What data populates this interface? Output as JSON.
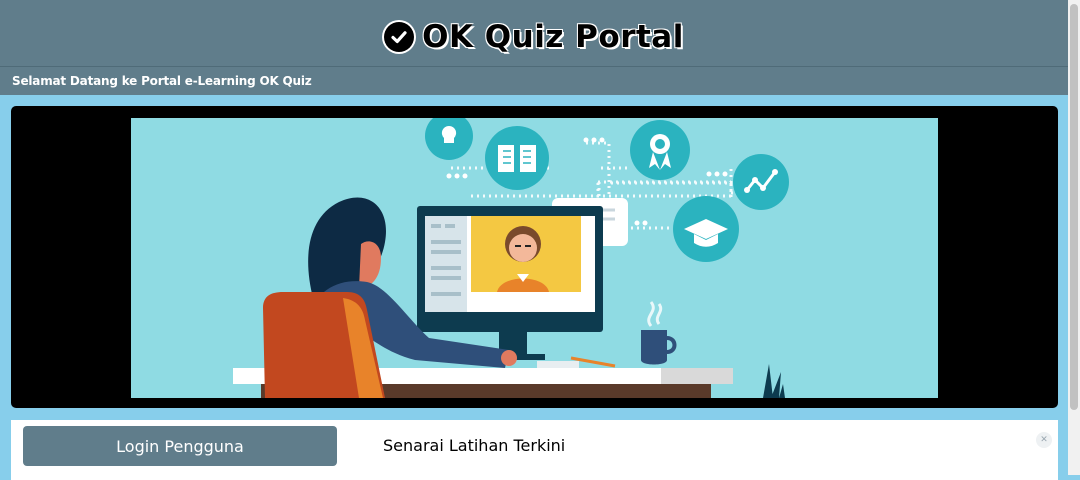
{
  "header": {
    "title": "OK Quiz Portal",
    "icon": "check-circle-icon"
  },
  "subbar": {
    "welcome": "Selamat Datang ke Portal e-Learning OK Quiz"
  },
  "banner": {
    "image": "e-learning-illustration"
  },
  "panel": {
    "login_label": "Login Pengguna",
    "list_title": "Senarai Latihan Terkini"
  },
  "colors": {
    "header_bg": "#607d8b",
    "page_bg": "#87ceeb",
    "banner_bg": "#000000",
    "illustration_bg": "#8fdbe3",
    "accent": "#2bb3bf"
  }
}
